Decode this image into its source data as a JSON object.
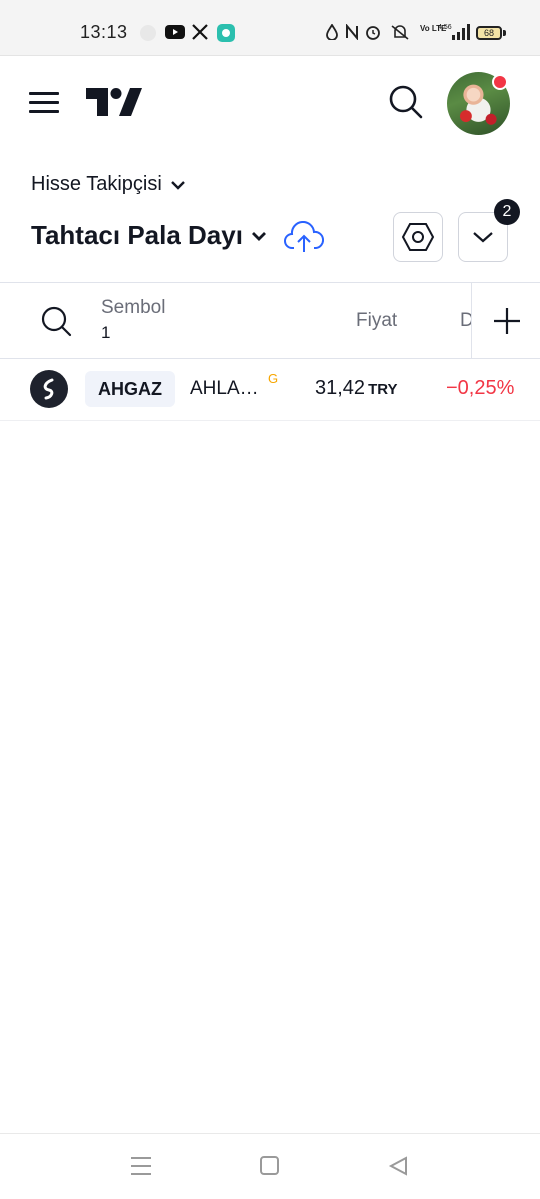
{
  "status_bar": {
    "time": "13:13",
    "network": "Vo LTE",
    "speed": "4,56",
    "battery": "68",
    "icons": [
      "notification-icon",
      "youtube-icon",
      "x-icon",
      "chat-icon",
      "water-drop-icon",
      "nfc-icon",
      "alarm-icon",
      "mute-icon",
      "vibrate-icon",
      "signal-icon"
    ]
  },
  "header": {
    "menu_icon": "hamburger-icon",
    "logo": "tradingview-logo",
    "search_icon": "search-icon",
    "avatar_status_color": "#f23645"
  },
  "watchlist": {
    "section_label": "Hisse Takipçisi",
    "list_name": "Tahtacı Pala Dayı",
    "notification_count": "2"
  },
  "table": {
    "columns": {
      "symbol": "Sembol",
      "symbol_count": "1",
      "price": "Fiyat",
      "change": "D"
    },
    "rows": [
      {
        "ticker": "AHGAZ",
        "name": "AHLA…",
        "flag": "G",
        "price": "31,42",
        "currency": "TRY",
        "change": "−0,25%",
        "change_color": "#f23645"
      }
    ]
  },
  "nav": {
    "icons": [
      "recents-icon",
      "home-icon",
      "back-icon"
    ]
  }
}
